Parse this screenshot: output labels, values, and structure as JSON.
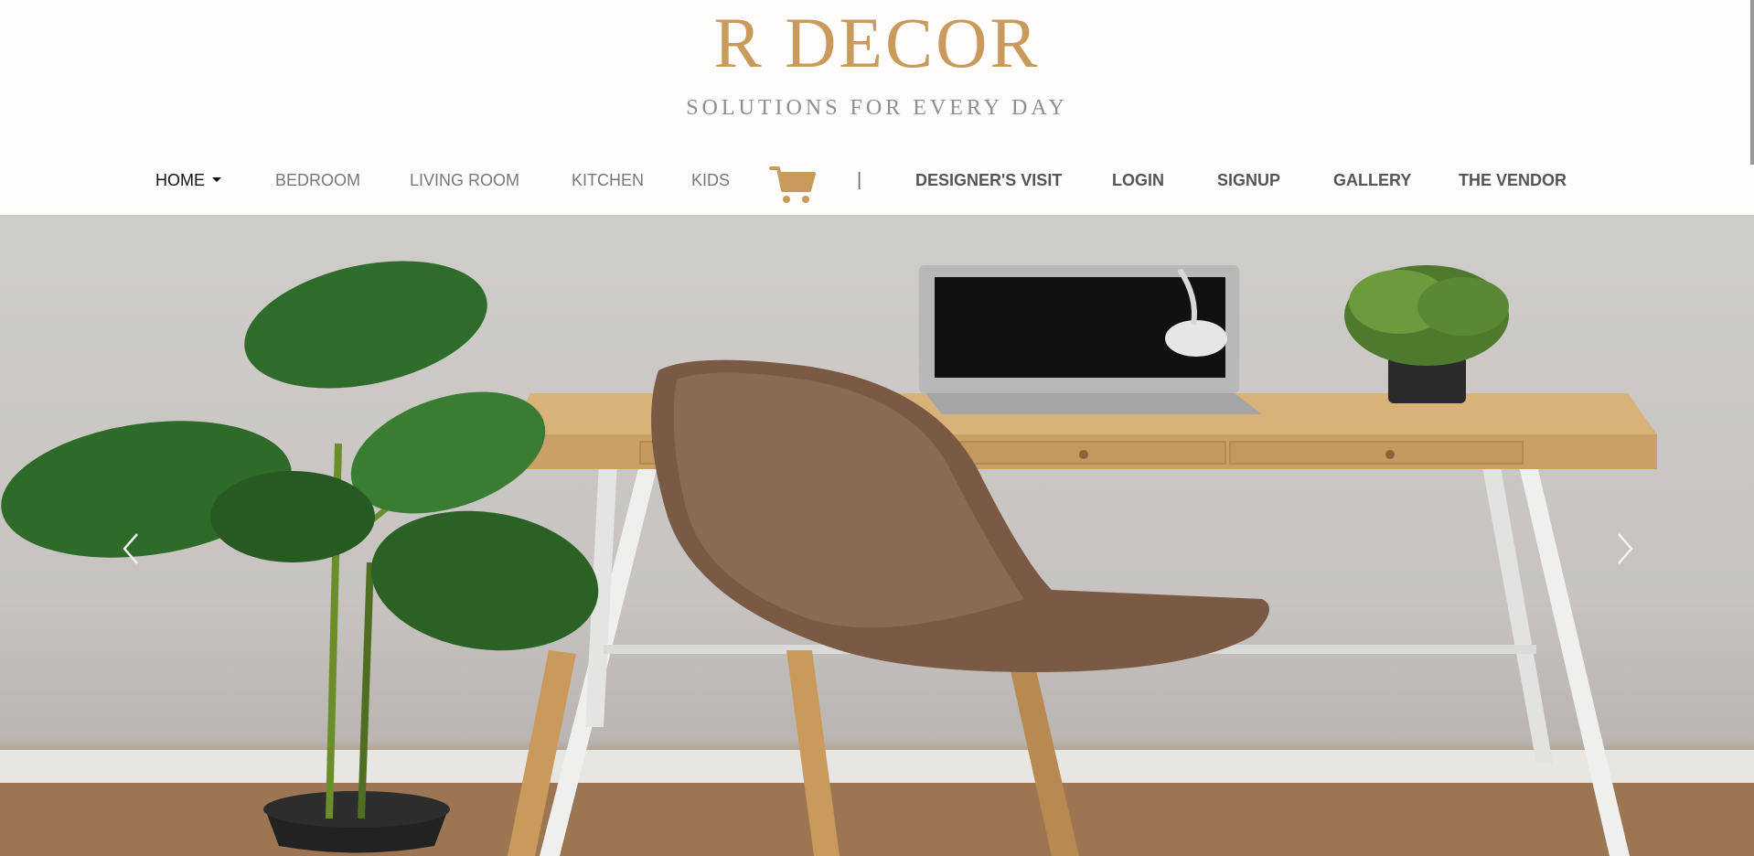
{
  "brand": {
    "title": "R DECOR",
    "tagline": "SOLUTIONS FOR EVERY DAY"
  },
  "nav": {
    "home": "HOME",
    "bedroom": "BEDROOM",
    "living_room": "LIVING ROOM",
    "kitchen": "KITCHEN",
    "kids": "KIDS",
    "separator": "|",
    "designers_visit": "DESIGNER'S VISIT",
    "login": "LOGIN",
    "signup": "SIGNUP",
    "gallery": "GALLERY",
    "vendor": "THE VENDOR"
  },
  "icons": {
    "cart": "shopping-cart-icon",
    "prev": "chevron-left-icon",
    "next": "chevron-right-icon"
  },
  "colors": {
    "brand": "#c99a5b",
    "tagline": "#8e8e8e",
    "nav_active": "#111111",
    "nav_default": "#777777"
  }
}
